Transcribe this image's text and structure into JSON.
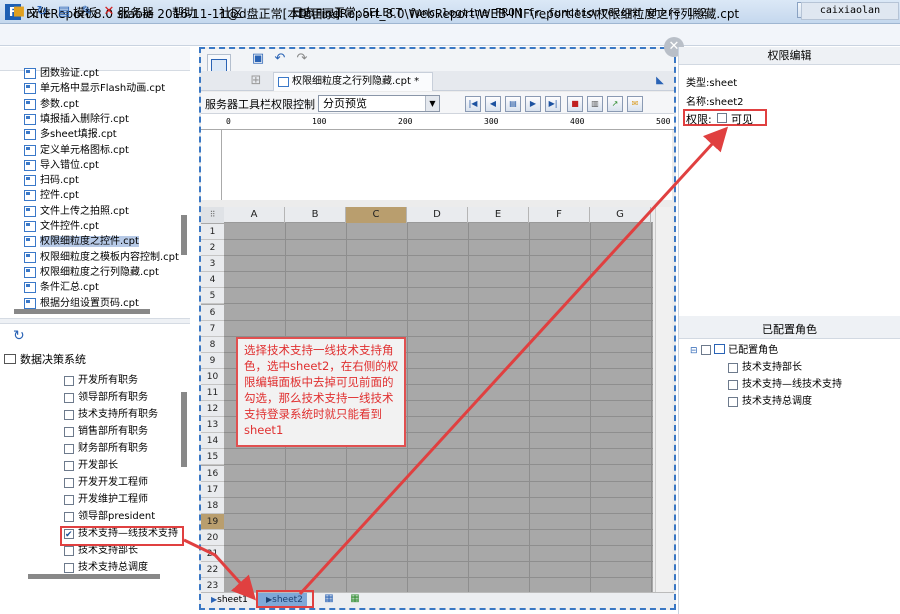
{
  "window": {
    "app_title": "FineReport 8.0 stable 2016-11-11@d盘正常[本地目录]",
    "file_path": "D:\\FineReport_8.0\\WebReport\\WEB-INF\\reportlets\\权限细粒度之行列隐藏.cpt",
    "minimize": "–",
    "maximize": "□",
    "close": "✕"
  },
  "menu": {
    "items": [
      "文件",
      "模板",
      "服务器",
      "帮助",
      "社区"
    ],
    "log_label": "日志",
    "log_text": "正常:SELECT func,logtime FROM fr_functionrecord where 1=2",
    "user": "caixiaolan"
  },
  "file_list": [
    "团数验证.cpt",
    "单元格中显示Flash动画.cpt",
    "参数.cpt",
    "填报插入删除行.cpt",
    "多sheet填报.cpt",
    "定义单元格图标.cpt",
    "导入错位.cpt",
    "扫码.cpt",
    "控件.cpt",
    "文件上传之拍照.cpt",
    "文件控件.cpt",
    "权限细粒度之控件.cpt",
    "权限细粒度之模板内容控制.cpt",
    "权限细粒度之行列隐藏.cpt",
    "条件汇总.cpt",
    "根据分组设置页码.cpt"
  ],
  "roles": {
    "root": "数据决策系统",
    "items": [
      "开发所有职务",
      "领导部所有职务",
      "技术支持所有职务",
      "销售部所有职务",
      "财务部所有职务",
      "开发部长",
      "开发开发工程师",
      "开发维护工程师",
      "领导部president",
      "技术支持—线技术支持",
      "技术支持部长",
      "技术支持总调度"
    ]
  },
  "editor": {
    "tab_title": "权限细粒度之行列隐藏.cpt *",
    "toolbar_perm_label": "服务器工具栏权限控制",
    "preview_mode": "分页预览",
    "ruler_marks": [
      "0",
      "100",
      "200",
      "300",
      "400",
      "500"
    ],
    "columns": [
      "A",
      "B",
      "C",
      "D",
      "E",
      "F",
      "G"
    ],
    "rows": [
      "1",
      "2",
      "3",
      "4",
      "5",
      "6",
      "7",
      "8",
      "9",
      "10",
      "11",
      "12",
      "13",
      "14",
      "15",
      "16",
      "17",
      "18",
      "19",
      "20",
      "21",
      "22",
      "23"
    ],
    "selected_column": "C",
    "selected_row": "19",
    "sheets": [
      "sheet1",
      "sheet2"
    ]
  },
  "right_panel": {
    "header": "权限编辑",
    "type_line": "类型:sheet",
    "name_line": "名称:sheet2",
    "perm_label": "权限:",
    "visible_label": "可见",
    "configured_header": "已配置角色",
    "configured_root": "已配置角色",
    "configured_roles": [
      "技术支持部长",
      "技术支持—线技术支持",
      "技术支持总调度"
    ]
  },
  "annotation": {
    "text": "选择技术支持一线技术支持角色，选中sheet2，在右侧的权限编辑面板中去掉可见前面的勾选，那么技术支持一线技术支持登录系统时就只能看到sheet1"
  },
  "colors": {
    "accent": "#3977c4",
    "highlight_red": "#e04040",
    "selected_header": "#b99e6e",
    "grid_bg": "#a8a8a8"
  }
}
